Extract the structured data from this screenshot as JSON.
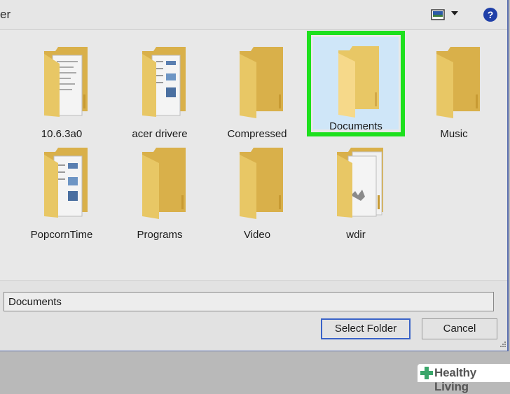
{
  "window": {
    "title_fragment": "er"
  },
  "toolbar": {
    "view_icon": "change-view-icon",
    "dropdown_icon": "chevron-down-icon",
    "help_label": "?"
  },
  "items": [
    {
      "label": "10.6.3a0",
      "icon": "folder-documents-icon"
    },
    {
      "label": "acer drivere",
      "icon": "folder-documents-icon"
    },
    {
      "label": "Compressed",
      "icon": "folder-icon"
    },
    {
      "label": "Documents",
      "icon": "folder-icon",
      "selected": true
    },
    {
      "label": "Music",
      "icon": "folder-icon"
    },
    {
      "label": "PopcornTime",
      "icon": "folder-documents-icon"
    },
    {
      "label": "Programs",
      "icon": "folder-icon"
    },
    {
      "label": "Video",
      "icon": "folder-icon"
    },
    {
      "label": "wdir",
      "icon": "folder-documents-icon"
    }
  ],
  "footer": {
    "folder_name_value": "Documents",
    "select_label": "Select Folder",
    "cancel_label": "Cancel"
  },
  "watermark": {
    "text": "Healthy Living"
  },
  "colors": {
    "highlight": "#1de01d",
    "selection": "#cfe6f8",
    "folder": "#e6c35c",
    "accent": "#3a63c8"
  }
}
